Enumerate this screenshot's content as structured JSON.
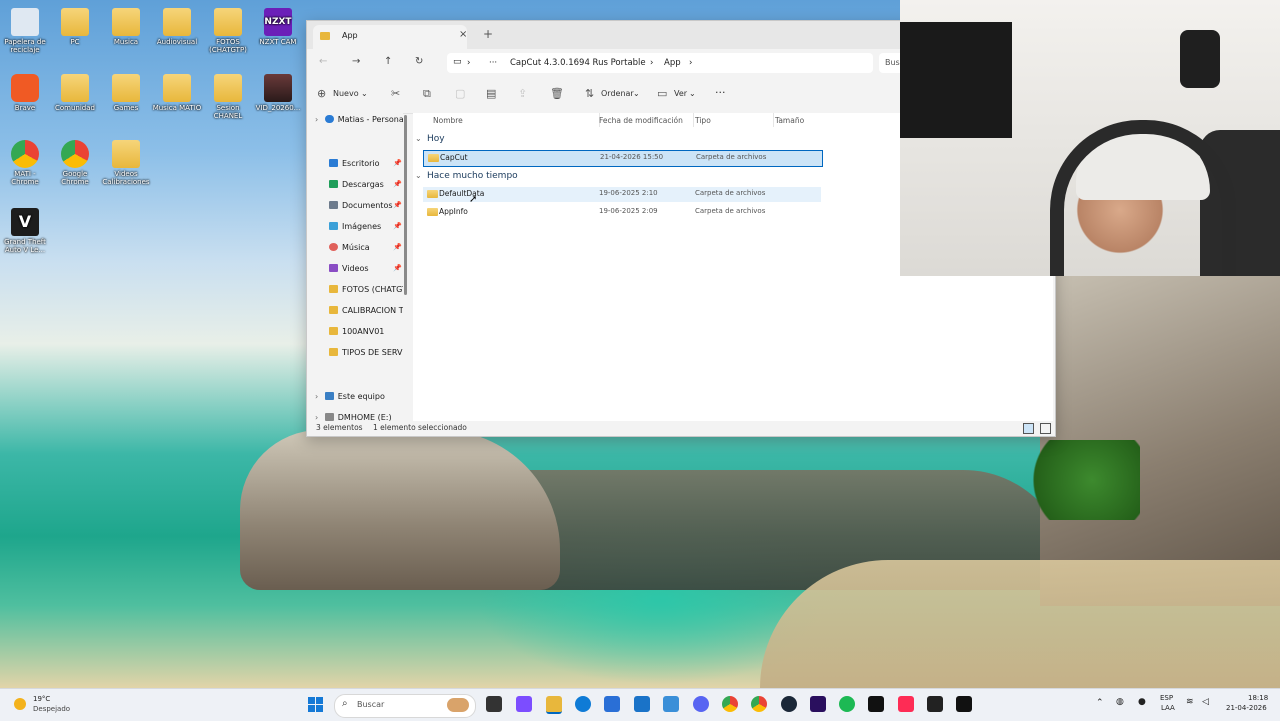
{
  "desktop": {
    "icons": [
      {
        "label": "Papelera de reciclaje",
        "icon": "recycle-bin-icon"
      },
      {
        "label": "PC",
        "icon": "folder-icon"
      },
      {
        "label": "Musica",
        "icon": "folder-icon"
      },
      {
        "label": "Audiovisual",
        "icon": "folder-icon"
      },
      {
        "label": "FOTOS (CHATGTP)",
        "icon": "folder-icon"
      },
      {
        "label": "NZXT CAM",
        "icon": "nzxt-cam-icon"
      },
      {
        "label": "Brave",
        "icon": "brave-icon"
      },
      {
        "label": "Comunidad",
        "icon": "folder-icon"
      },
      {
        "label": "Games",
        "icon": "folder-icon"
      },
      {
        "label": "Musica MATIO",
        "icon": "folder-icon"
      },
      {
        "label": "Sesion CHANEL",
        "icon": "folder-icon"
      },
      {
        "label": "VID_20260...",
        "icon": "video-file-icon"
      },
      {
        "label": "MATI - Chrome",
        "icon": "chrome-icon"
      },
      {
        "label": "Google Chrome",
        "icon": "chrome-icon"
      },
      {
        "label": "Videos Calibraciones",
        "icon": "folder-icon"
      },
      {
        "label": "Grand Theft Auto V Le...",
        "icon": "gta-icon"
      }
    ],
    "nzxt_text": "NZXT"
  },
  "explorer": {
    "tab_title": "App",
    "tab_close": "×",
    "tab_add": "+",
    "breadcrumb": [
      "CapCut 4.3.0.1694 Rus Portable",
      "App"
    ],
    "breadcrumb_more": "···",
    "search_placeholder": "Bus",
    "commands": {
      "new": "Nuevo",
      "sort": "Ordenar",
      "view": "Ver",
      "more": "···"
    },
    "sidebar": {
      "top": "Matias - Persona",
      "items": [
        {
          "label": "Escritorio",
          "pinned": true,
          "color": "#2a7bd4"
        },
        {
          "label": "Descargas",
          "pinned": true,
          "color": "#1f9e5a"
        },
        {
          "label": "Documentos",
          "pinned": true,
          "color": "#6d7b8c"
        },
        {
          "label": "Imágenes",
          "pinned": true,
          "color": "#3ba0d8"
        },
        {
          "label": "Música",
          "pinned": true,
          "color": "#e0605a"
        },
        {
          "label": "Videos",
          "pinned": true,
          "color": "#8a4dc4"
        },
        {
          "label": "FOTOS (CHATGT",
          "pinned": false,
          "color": "#e8b73c"
        },
        {
          "label": "CALIBRACION T",
          "pinned": false,
          "color": "#e8b73c"
        },
        {
          "label": "100ANV01",
          "pinned": false,
          "color": "#e8b73c"
        },
        {
          "label": "TIPOS DE SERVIC",
          "pinned": false,
          "color": "#e8b73c"
        }
      ],
      "this_pc": "Este equipo",
      "drive": "DMHOME (E:)"
    },
    "columns": {
      "name": "Nombre",
      "modified": "Fecha de modificación",
      "type": "Tipo",
      "size": "Tamaño"
    },
    "groups": [
      {
        "label": "Hoy",
        "rows": [
          {
            "name": "CapCut",
            "modified": "21-04-2026 15:50",
            "type": "Carpeta de archivos",
            "selected": true
          }
        ]
      },
      {
        "label": "Hace mucho tiempo",
        "rows": [
          {
            "name": "DefaultData",
            "modified": "19-06-2025 2:10",
            "type": "Carpeta de archivos",
            "hover": true
          },
          {
            "name": "AppInfo",
            "modified": "19-06-2025 2:09",
            "type": "Carpeta de archivos"
          }
        ]
      }
    ],
    "status": {
      "count": "3 elementos",
      "selection": "1 elemento seleccionado"
    }
  },
  "taskbar": {
    "weather_temp": "19°C",
    "weather_cond": "Despejado",
    "search_placeholder": "Buscar",
    "apps": [
      {
        "name": "task-view",
        "color": "#333"
      },
      {
        "name": "copilot",
        "color": "#7c4dff"
      },
      {
        "name": "file-explorer",
        "color": "#e8b73c"
      },
      {
        "name": "edge",
        "color": "#0f7bd6"
      },
      {
        "name": "store",
        "color": "#2a6fd6"
      },
      {
        "name": "outlook",
        "color": "#1a73c8"
      },
      {
        "name": "notepad",
        "color": "#3a8fd8"
      },
      {
        "name": "discord",
        "color": "#5865f2"
      },
      {
        "name": "chrome",
        "color": "#34a853"
      },
      {
        "name": "chrome-profile",
        "color": "#ea4335"
      },
      {
        "name": "steam",
        "color": "#1b2838"
      },
      {
        "name": "premiere",
        "color": "#2a0f5e"
      },
      {
        "name": "spotify",
        "color": "#1db954"
      },
      {
        "name": "capcut",
        "color": "#111"
      },
      {
        "name": "tiktok",
        "color": "#fe2c55"
      },
      {
        "name": "live",
        "color": "#222"
      },
      {
        "name": "capcut-alt",
        "color": "#111"
      }
    ],
    "lang": "ESP",
    "lang_sub": "LAA",
    "time": "18:18",
    "date": "21-04-2026"
  }
}
